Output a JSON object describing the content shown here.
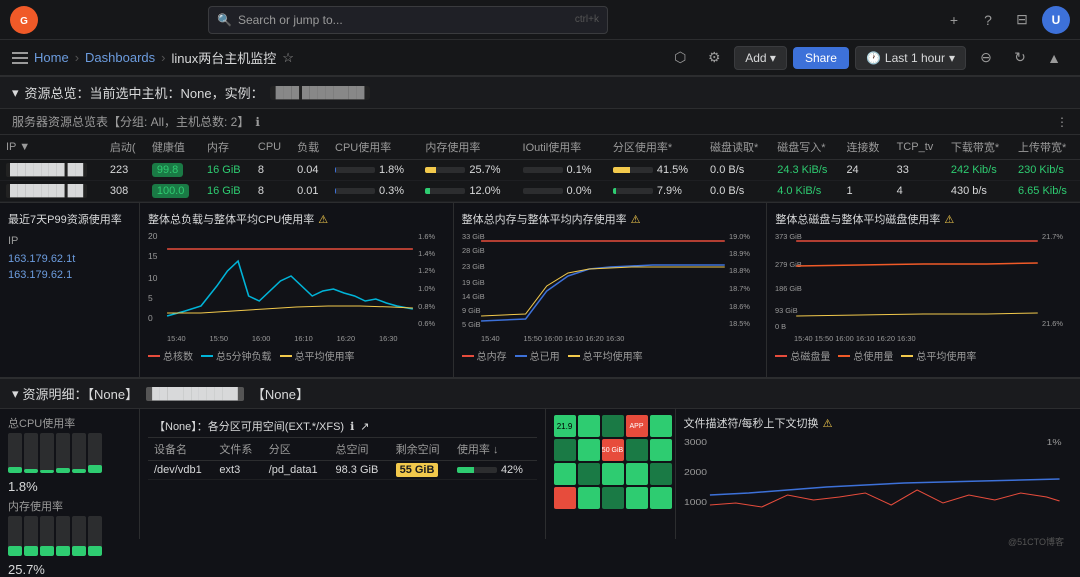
{
  "nav": {
    "search_placeholder": "Search or jump to...",
    "shortcut": "ctrl+k",
    "plus_icon": "+",
    "help_icon": "?",
    "rss_icon": "⊟",
    "avatar_text": "U"
  },
  "toolbar": {
    "home": "Home",
    "dashboards": "Dashboards",
    "current_page": "linux两台主机监控",
    "add_label": "Add ▾",
    "share_label": "Share",
    "time_range": "Last 1 hour",
    "zoom_out": "⊖",
    "refresh": "↻",
    "chevron": "▾"
  },
  "resource_section": {
    "title": "资源总览：当前选中主机：None，实例：",
    "instance_value": "███ ████████"
  },
  "server_table": {
    "header": "服务器资源总览表【分组: All，主机总数: 2】",
    "info_icon": "ℹ",
    "columns": [
      "IP ▼",
      "启动(",
      "健康值",
      "内存",
      "CPU",
      "负载",
      "CPU使用率",
      "内存使用率",
      "IOutil使用率",
      "分区使用率*",
      "磁盘读取*",
      "磁盘写入*",
      "连接数",
      "TCP_tv",
      "下载带宽*",
      "上传带宽*"
    ],
    "rows": [
      {
        "ip": "███████ ██",
        "uptime": "223",
        "health": "99.8",
        "health_color": "green",
        "memory": "16 GiB",
        "cpu": "8",
        "load": "0.04",
        "cpu_pct": "1.8%",
        "cpu_bar": 2,
        "mem_pct": "25.7%",
        "mem_bar": 26,
        "io_pct": "0.1%",
        "io_bar": 0,
        "disk_pct": "41.5%",
        "disk_bar": 42,
        "disk_read": "0.0 B/s",
        "disk_write": "24.3 KiB/s",
        "connections": "24",
        "tcp": "33",
        "download": "242 Kib/s",
        "upload": "230 Kib/s"
      },
      {
        "ip": "███████ ██",
        "uptime": "308",
        "health": "100.0",
        "health_color": "green",
        "memory": "16 GiB",
        "cpu": "8",
        "load": "0.01",
        "cpu_pct": "0.3%",
        "cpu_bar": 0,
        "mem_pct": "12.0%",
        "mem_bar": 12,
        "io_pct": "0.0%",
        "io_bar": 0,
        "disk_pct": "7.9%",
        "disk_bar": 8,
        "disk_read": "0.0 B/s",
        "disk_write": "4.0 KiB/s",
        "connections": "1",
        "tcp": "4",
        "download": "430 b/s",
        "upload": "6.65 Kib/s"
      }
    ]
  },
  "charts": {
    "p99_title": "最近7天P99资源使用率",
    "p99_ips": [
      "163.179.62.1",
      "163.179.62.1"
    ],
    "load_title": "整体总负载与整体平均CPU使用率",
    "mem_title": "整体总内存与整体平均内存使用率",
    "disk_title": "整体总磁盘与整体平均磁盘使用率",
    "load_legend": [
      "总核数",
      "总5分钟负载",
      "总平均使用率"
    ],
    "mem_legend": [
      "总内存",
      "总已用",
      "总平均使用率"
    ],
    "disk_legend": [
      "总磁盘量",
      "总使用量",
      "总平均使用率"
    ],
    "load_y_labels": [
      "20",
      "15",
      "10",
      "5",
      "0"
    ],
    "load_y2_labels": [
      "1.6%",
      "1.4%",
      "1.2%",
      "1.0%",
      "0.8%",
      "0.6%"
    ],
    "load_x_labels": [
      "15:40",
      "15:50",
      "16:00",
      "16:10",
      "16:20",
      "16:30"
    ],
    "mem_y_labels": [
      "33 GiB",
      "28 GiB",
      "23 GiB",
      "19 GiB",
      "14 GiB",
      "9 GiB",
      "5 GiB"
    ],
    "mem_y2_labels": [
      "19.0%",
      "18.9%",
      "18.8%",
      "18.7%",
      "18.6%",
      "18.5%"
    ],
    "mem_x_labels": [
      "15:40",
      "15:50 16:00 16:10 16:20 16:30"
    ],
    "disk_y_labels": [
      "373 GiB",
      "279 GiB",
      "186 GiB",
      "93 GiB",
      "0 B"
    ],
    "disk_y2_labels": [
      "21.7%",
      "",
      "",
      "21.6%"
    ]
  },
  "resource_detail": {
    "title": "资源明细：【None】",
    "tag1": "███████████",
    "tag2": "【None】"
  },
  "bottom": {
    "cpu_title": "总CPU使用率",
    "cpu_value": "1.8%",
    "mem_title": "内存使用率",
    "mem_value": "25.7%",
    "table_title": "【None】：各分区可用空间(EXT.*/XFS)",
    "table_columns": [
      "设备名",
      "文件系",
      "分区",
      "总空间",
      "剩余空间",
      "使用率 ↓"
    ],
    "table_row": {
      "device": "/dev/vdb1",
      "fstype": "ext3",
      "partition": "/pd_data1",
      "total": "98.3 GiB",
      "free": "55 GiB",
      "usage": "42%"
    },
    "file_desc_title": "文件描述符/每秒上下文切换",
    "heatmap_label": "APP"
  }
}
